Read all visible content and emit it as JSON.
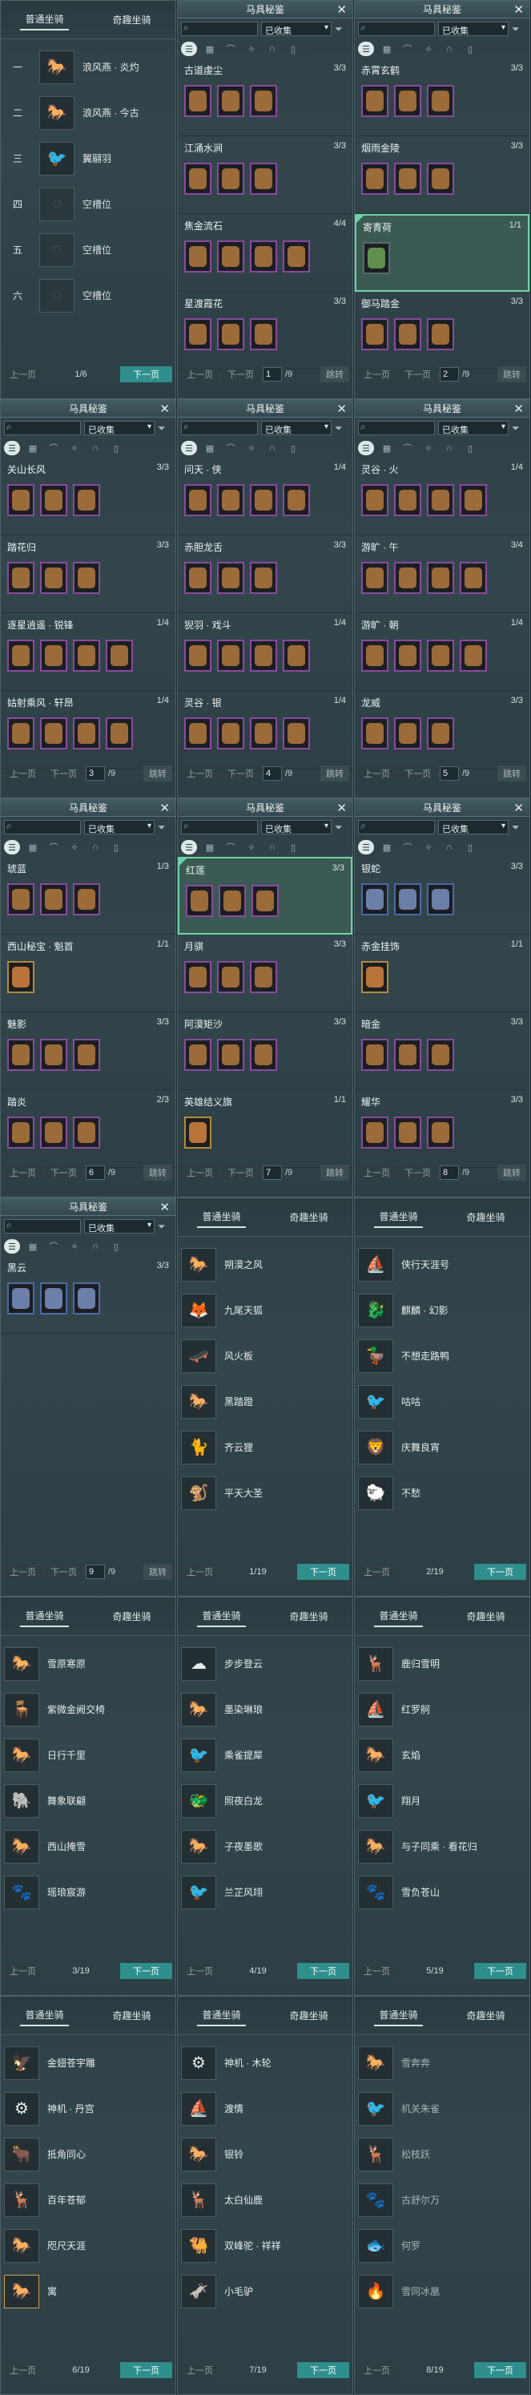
{
  "ui": {
    "codex_title": "马具秘鉴",
    "close_icon": "close-icon",
    "filter_value": "已收集",
    "filter_icon": "funnel-icon",
    "search_icon": "search-icon",
    "category_icons": [
      "list-icon",
      "grid-icon",
      "saddle-icon",
      "wing-icon",
      "horseshoe-icon",
      "shield-icon"
    ],
    "prev_label": "上一页",
    "next_label": "下一页",
    "jump_label": "跳转",
    "tab_normal": "普通坐骑",
    "tab_fun": "奇趣坐骑",
    "accent_colors": {
      "selected": "#6fd2a6",
      "next_button": "#2f8f8d",
      "purple_frame": "#8b4aa0",
      "blue_frame": "#4a6aa8",
      "gold_frame": "#b58a3a"
    }
  },
  "panels": [
    {
      "type": "slots",
      "page_label": "1/6",
      "rows": [
        {
          "order": "一",
          "name": "浪风燕 · 炎灼",
          "icon": "horse-icon",
          "empty": false
        },
        {
          "order": "二",
          "name": "浪风燕 · 今古",
          "icon": "horse-icon",
          "empty": false
        },
        {
          "order": "三",
          "name": "翼翮羽",
          "icon": "bird-icon",
          "empty": false
        },
        {
          "order": "四",
          "name": "空槽位",
          "icon": "empty-slot-icon",
          "empty": true
        },
        {
          "order": "五",
          "name": "空槽位",
          "icon": "empty-slot-icon",
          "empty": true
        },
        {
          "order": "六",
          "name": "空槽位",
          "icon": "empty-slot-icon",
          "empty": true
        }
      ]
    },
    {
      "type": "codex",
      "page": "1",
      "total": "/9",
      "cards": [
        {
          "name": "古道虔尘",
          "count": "3/3",
          "slots": [
            "p",
            "p",
            "p"
          ]
        },
        {
          "name": "江涌水涧",
          "count": "3/3",
          "slots": [
            "p",
            "p",
            "p"
          ]
        },
        {
          "name": "焦金流石",
          "count": "4/4",
          "slots": [
            "p",
            "p",
            "p",
            "p"
          ]
        },
        {
          "name": "星渡霞花",
          "count": "3/3",
          "slots": [
            "p",
            "p",
            "p"
          ]
        }
      ]
    },
    {
      "type": "codex",
      "page": "2",
      "total": "/9",
      "cards": [
        {
          "name": "赤霄玄鹤",
          "count": "3/3",
          "slots": [
            "p",
            "p",
            "p"
          ]
        },
        {
          "name": "烟雨金陵",
          "count": "3/3",
          "slots": [
            "p",
            "p",
            "p"
          ]
        },
        {
          "name": "寄青荷",
          "count": "1/1",
          "slots": [
            "g"
          ],
          "selected": true
        },
        {
          "name": "御马踏金",
          "count": "3/3",
          "slots": [
            "p",
            "p",
            "p"
          ]
        }
      ]
    },
    {
      "type": "codex",
      "page": "3",
      "total": "/9",
      "cards": [
        {
          "name": "关山长风",
          "count": "3/3",
          "slots": [
            "p",
            "p",
            "p"
          ]
        },
        {
          "name": "踏花归",
          "count": "3/3",
          "slots": [
            "p",
            "p",
            "p"
          ]
        },
        {
          "name": "逐星逍遥 · 锐锋",
          "count": "1/4",
          "slots": [
            "p",
            "p",
            "p",
            "p"
          ]
        },
        {
          "name": "姑射乘风 · 轩昂",
          "count": "1/4",
          "slots": [
            "p",
            "p",
            "p",
            "p"
          ]
        }
      ]
    },
    {
      "type": "codex",
      "page": "4",
      "total": "/9",
      "cards": [
        {
          "name": "问天 · 侠",
          "count": "1/4",
          "slots": [
            "p",
            "p",
            "p",
            "p"
          ]
        },
        {
          "name": "赤胆龙舌",
          "count": "3/3",
          "slots": [
            "p",
            "p",
            "p"
          ]
        },
        {
          "name": "猊羽 · 戏斗",
          "count": "1/4",
          "slots": [
            "p",
            "p",
            "p",
            "p"
          ]
        },
        {
          "name": "灵谷 · 银",
          "count": "1/4",
          "slots": [
            "p",
            "p",
            "p",
            "p"
          ]
        }
      ]
    },
    {
      "type": "codex",
      "page": "5",
      "total": "/9",
      "cards": [
        {
          "name": "灵谷 · 火",
          "count": "1/4",
          "slots": [
            "p",
            "p",
            "p",
            "p"
          ]
        },
        {
          "name": "游旷 · 午",
          "count": "3/4",
          "slots": [
            "p",
            "p",
            "p",
            "p"
          ]
        },
        {
          "name": "游旷 · 朝",
          "count": "1/4",
          "slots": [
            "p",
            "p",
            "p",
            "p"
          ]
        },
        {
          "name": "龙威",
          "count": "3/3",
          "slots": [
            "p",
            "p",
            "p"
          ]
        }
      ]
    },
    {
      "type": "codex",
      "page": "6",
      "total": "/9",
      "cards": [
        {
          "name": "琥蓝",
          "count": "1/3",
          "slots": [
            "p",
            "p",
            "p"
          ]
        },
        {
          "name": "西山秘宝 · 魁首",
          "count": "1/1",
          "slots": [
            "o"
          ]
        },
        {
          "name": "魅影",
          "count": "3/3",
          "slots": [
            "p",
            "p",
            "p"
          ]
        },
        {
          "name": "踏炎",
          "count": "2/3",
          "slots": [
            "p",
            "p",
            "p"
          ]
        }
      ]
    },
    {
      "type": "codex",
      "page": "7",
      "total": "/9",
      "cards": [
        {
          "name": "红莲",
          "count": "3/3",
          "slots": [
            "p",
            "p",
            "p"
          ],
          "selected": true
        },
        {
          "name": "月骐",
          "count": "3/3",
          "slots": [
            "p",
            "p",
            "p"
          ]
        },
        {
          "name": "阿漠矩沙",
          "count": "3/3",
          "slots": [
            "p",
            "p",
            "p"
          ]
        },
        {
          "name": "英雄结义旗",
          "count": "1/1",
          "slots": [
            "o"
          ]
        }
      ]
    },
    {
      "type": "codex",
      "page": "8",
      "total": "/9",
      "cards": [
        {
          "name": "银蛇",
          "count": "3/3",
          "slots": [
            "b",
            "b",
            "b"
          ]
        },
        {
          "name": "赤金挂饰",
          "count": "1/1",
          "slots": [
            "o"
          ]
        },
        {
          "name": "暗金",
          "count": "3/3",
          "slots": [
            "p",
            "p",
            "p"
          ]
        },
        {
          "name": "耀华",
          "count": "3/3",
          "slots": [
            "p",
            "p",
            "p"
          ]
        }
      ]
    },
    {
      "type": "codex",
      "page": "9",
      "total": "/9",
      "cards": [
        {
          "name": "黑云",
          "count": "3/3",
          "slots": [
            "b",
            "b",
            "b"
          ]
        }
      ]
    },
    {
      "type": "mounts",
      "page_label": "1/19",
      "rows": [
        {
          "name": "朔漠之风",
          "icon": "horse-icon"
        },
        {
          "name": "九尾天狐",
          "icon": "fox-icon"
        },
        {
          "name": "风火板",
          "icon": "board-icon"
        },
        {
          "name": "黑踏蹬",
          "icon": "horse-icon"
        },
        {
          "name": "齐云狸",
          "icon": "cat-icon"
        },
        {
          "name": "平天大圣",
          "icon": "monkey-icon"
        }
      ]
    },
    {
      "type": "mounts",
      "page_label": "2/19",
      "rows": [
        {
          "name": "侠行天涯号",
          "icon": "ship-icon"
        },
        {
          "name": "麒麟 · 幻影",
          "icon": "qilin-icon"
        },
        {
          "name": "不想走路鸭",
          "icon": "duck-icon"
        },
        {
          "name": "咕咕",
          "icon": "bird-icon"
        },
        {
          "name": "庆舞良宵",
          "icon": "lion-icon"
        },
        {
          "name": "不愁",
          "icon": "sheep-icon"
        }
      ]
    },
    {
      "type": "mounts",
      "page_label": "3/19",
      "rows": [
        {
          "name": "雪原寒原",
          "icon": "horse-icon"
        },
        {
          "name": "紫微金阙交椅",
          "icon": "chair-icon"
        },
        {
          "name": "日行千里",
          "icon": "horse-icon"
        },
        {
          "name": "舞象联翩",
          "icon": "elephant-icon"
        },
        {
          "name": "西山掩雪",
          "icon": "horse-icon"
        },
        {
          "name": "瑶琅宸游",
          "icon": "beast-icon"
        }
      ]
    },
    {
      "type": "mounts",
      "page_label": "4/19",
      "rows": [
        {
          "name": "步步登云",
          "icon": "cloud-icon"
        },
        {
          "name": "墨染琳琅",
          "icon": "horse-icon"
        },
        {
          "name": "乘雀提犀",
          "icon": "bird-icon"
        },
        {
          "name": "照夜白龙",
          "icon": "dragon-icon"
        },
        {
          "name": "子夜墨歌",
          "icon": "horse-icon"
        },
        {
          "name": "兰芷风翊",
          "icon": "bird-icon"
        }
      ]
    },
    {
      "type": "mounts",
      "page_label": "5/19",
      "rows": [
        {
          "name": "鹿归雪明",
          "icon": "deer-icon"
        },
        {
          "name": "红罗舸",
          "icon": "boat-icon"
        },
        {
          "name": "玄焰",
          "icon": "horse-icon"
        },
        {
          "name": "翔月",
          "icon": "bird-icon"
        },
        {
          "name": "与子同乘 · 看花归",
          "icon": "horse-icon"
        },
        {
          "name": "雪负苍山",
          "icon": "beast-icon"
        }
      ]
    },
    {
      "type": "mounts",
      "page_label": "6/19",
      "rows": [
        {
          "name": "金翅苍宇雕",
          "icon": "eagle-icon"
        },
        {
          "name": "神机 · 丹宫",
          "icon": "mech-icon"
        },
        {
          "name": "抵角同心",
          "icon": "ox-icon"
        },
        {
          "name": "百年苍郁",
          "icon": "deer-icon"
        },
        {
          "name": "咫尺天涯",
          "icon": "horse-icon"
        },
        {
          "name": "寓",
          "icon": "horse-icon",
          "highlight": true
        }
      ]
    },
    {
      "type": "mounts",
      "page_label": "7/19",
      "rows": [
        {
          "name": "神机 · 木轮",
          "icon": "mech-icon"
        },
        {
          "name": "渡情",
          "icon": "boat-icon"
        },
        {
          "name": "银铃",
          "icon": "horse-icon"
        },
        {
          "name": "太白仙鹿",
          "icon": "deer-icon"
        },
        {
          "name": "双峰驼 · 祥祥",
          "icon": "camel-icon"
        },
        {
          "name": "小毛驴",
          "icon": "donkey-icon"
        }
      ]
    },
    {
      "type": "mounts",
      "page_label": "8/19",
      "dark": true,
      "rows": [
        {
          "name": "雪奔奔",
          "icon": "horse-icon"
        },
        {
          "name": "机关朱雀",
          "icon": "bird-icon"
        },
        {
          "name": "松枝跃",
          "icon": "deer-icon"
        },
        {
          "name": "古舒尔万",
          "icon": "beast-icon"
        },
        {
          "name": "何罗",
          "icon": "fish-icon"
        },
        {
          "name": "雪同冰凰",
          "icon": "phoenix-icon"
        }
      ]
    }
  ]
}
